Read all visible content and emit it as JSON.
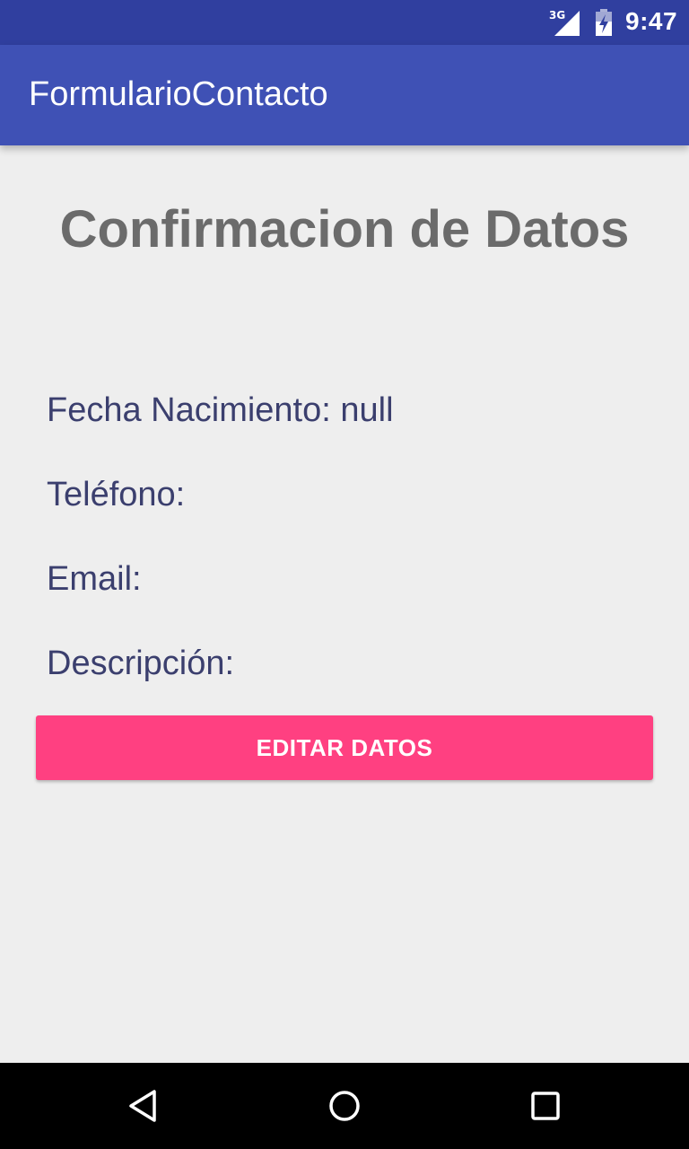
{
  "status_bar": {
    "network": "3G",
    "time": "9:47",
    "icons": [
      "signal-icon",
      "battery-icon"
    ]
  },
  "action_bar": {
    "title": "FormularioContacto"
  },
  "main": {
    "heading": "Confirmacion de Datos",
    "fields": {
      "fecha_nacimiento": "Fecha Nacimiento: null",
      "telefono": "Teléfono:",
      "email": "Email:",
      "descripcion": "Descripción:"
    },
    "edit_button_label": "EDITAR DATOS"
  },
  "nav_bar": {
    "icons": [
      "back-icon",
      "home-icon",
      "recent-apps-icon"
    ]
  },
  "colors": {
    "status_bar": "#303f9f",
    "action_bar": "#3f51b5",
    "accent": "#ff4081",
    "background": "#eeeeee",
    "field_text": "#3b3f6e",
    "heading_text": "#6b6b6b"
  }
}
